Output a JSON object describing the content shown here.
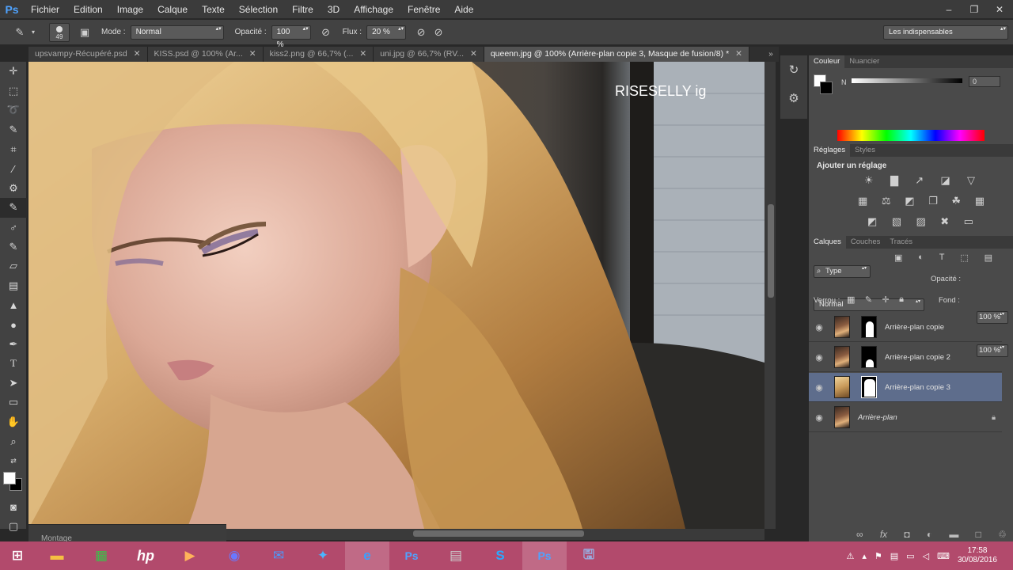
{
  "menu": {
    "app_logo": "Ps",
    "items": [
      "Fichier",
      "Edition",
      "Image",
      "Calque",
      "Texte",
      "Sélection",
      "Filtre",
      "3D",
      "Affichage",
      "Fenêtre",
      "Aide"
    ]
  },
  "window_controls": [
    "minimize-icon",
    "restore-icon",
    "close-icon"
  ],
  "options": {
    "brush_size": "49",
    "mode_label": "Mode :",
    "mode_value": "Normal",
    "opacity_label": "Opacité :",
    "opacity_value": "100 %",
    "flow_label": "Flux :",
    "flow_value": "20 %",
    "workspace": "Les indispensables"
  },
  "tabs": [
    {
      "label": "upsvampy-Récupéré.psd"
    },
    {
      "label": "KISS.psd @ 100% (Ar..."
    },
    {
      "label": "kiss2.png @ 66,7% (..."
    },
    {
      "label": "uni.jpg @ 66,7% (RV..."
    },
    {
      "label": "queenn.jpg @ 100% (Arrière-plan copie 3, Masque de fusion/8) *",
      "active": true
    }
  ],
  "canvas": {
    "watermark": "RISESELLY ig"
  },
  "montage_label": "Montage",
  "color_panel": {
    "tabs": [
      "Couleur",
      "Nuancier"
    ],
    "channel": "N",
    "value": "0"
  },
  "adjust_panel": {
    "tabs": [
      "Réglages",
      "Styles"
    ],
    "title": "Ajouter un réglage"
  },
  "layers_panel": {
    "tabs": [
      "Calques",
      "Couches",
      "Tracés"
    ],
    "filter": "Type",
    "blend_mode": "Normal",
    "opacity_label": "Opacité :",
    "opacity_value": "100 %",
    "lock_label": "Verrou :",
    "fill_label": "Fond :",
    "fill_value": "100 %",
    "layers": [
      {
        "name": "Arrière-plan copie"
      },
      {
        "name": "Arrière-plan copie 2"
      },
      {
        "name": "Arrière-plan copie 3",
        "active": true
      },
      {
        "name": "Arrière-plan",
        "locked": true
      }
    ]
  },
  "taskbar": {
    "apps": [
      "start-icon",
      "file-explorer-icon",
      "store-icon",
      "hp-icon",
      "media-player-icon",
      "video-icon",
      "mail-icon",
      "twitter-icon",
      "internet-explorer-icon",
      "photoshop-icon",
      "explorer-icon",
      "skype-icon",
      "photoshop-icon",
      "save-icon"
    ],
    "time": "17:58",
    "date": "30/08/2016"
  },
  "colors": {
    "taskbar": "#b24a6c",
    "accent": "#4fa3ff",
    "layer_active": "#5e6d8c"
  }
}
